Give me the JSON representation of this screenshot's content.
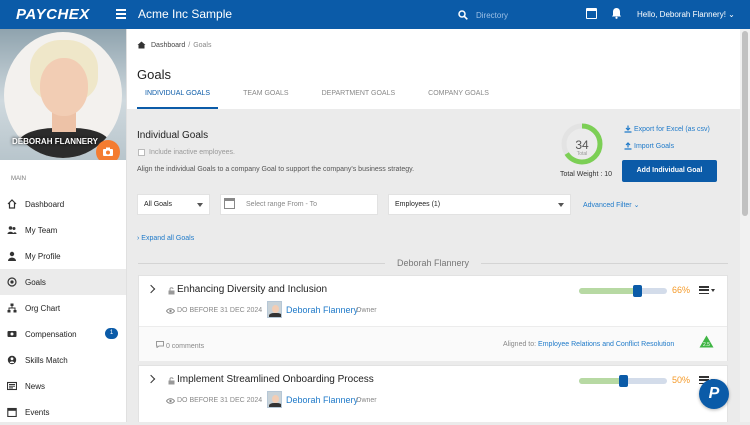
{
  "header": {
    "logo": "PAYCHEX",
    "app_title": "Acme Inc Sample",
    "search_placeholder": "Directory",
    "greeting": "Hello, Deborah Flannery!"
  },
  "profile": {
    "name": "DEBORAH FLANNERY"
  },
  "sidebar": {
    "section_label": "MAIN",
    "items": [
      {
        "label": "Dashboard",
        "icon": "home-icon"
      },
      {
        "label": "My Team",
        "icon": "team-icon"
      },
      {
        "label": "My Profile",
        "icon": "profile-icon"
      },
      {
        "label": "Goals",
        "icon": "target-icon",
        "active": true
      },
      {
        "label": "Org Chart",
        "icon": "org-chart-icon"
      },
      {
        "label": "Compensation",
        "icon": "money-icon",
        "badge": "1"
      },
      {
        "label": "Skills Match",
        "icon": "skills-icon"
      },
      {
        "label": "News",
        "icon": "news-icon"
      },
      {
        "label": "Events",
        "icon": "calendar-icon"
      }
    ]
  },
  "breadcrumb": {
    "home": "Dashboard",
    "sep": "/",
    "current": "Goals"
  },
  "page": {
    "title": "Goals"
  },
  "tabs": [
    "INDIVIDUAL GOALS",
    "TEAM GOALS",
    "DEPARTMENT GOALS",
    "COMPANY GOALS"
  ],
  "panel": {
    "title": "Individual Goals",
    "inactive_checkbox_label": "Include inactive employees.",
    "align_note": "Align the individual Goals to a company Goal to support the company's business strategy.",
    "donut_total": "34",
    "donut_sub": "Total",
    "donut_fraction": 0.66,
    "total_weight": "Total Weight : 10",
    "export_label": "Export for Excel (as csv)",
    "import_label": "Import Goals",
    "add_goal_label": "Add Individual Goal"
  },
  "filters": {
    "goals_filter": "All Goals",
    "date_placeholder": "Select range From - To",
    "employees_filter": "Employees (1)",
    "advanced_filter": "Advanced Filter"
  },
  "expand_all": "› Expand all Goals",
  "owner_group": "Deborah Flannery",
  "goals": [
    {
      "title": "Enhancing Diversity and Inclusion",
      "due": "DO BEFORE 31 DEC 2024",
      "owner": "Deborah Flannery",
      "role": "Owner",
      "progress": 0.66,
      "progress_label": "66%",
      "comments": "0 comments",
      "aligned_label": "Aligned to:",
      "aligned_to": "Employee Relations and Conflict Resolution",
      "badge": "2.5"
    },
    {
      "title": "Implement Streamlined Onboarding Process",
      "due": "DO BEFORE 31 DEC 2024",
      "owner": "Deborah Flannery",
      "role": "Owner",
      "progress": 0.5,
      "progress_label": "50%"
    }
  ],
  "colors": {
    "brand": "#0b5ba8",
    "accent": "#f47c30",
    "progress_pct": "#f59a28",
    "link": "#1f7ac9"
  }
}
